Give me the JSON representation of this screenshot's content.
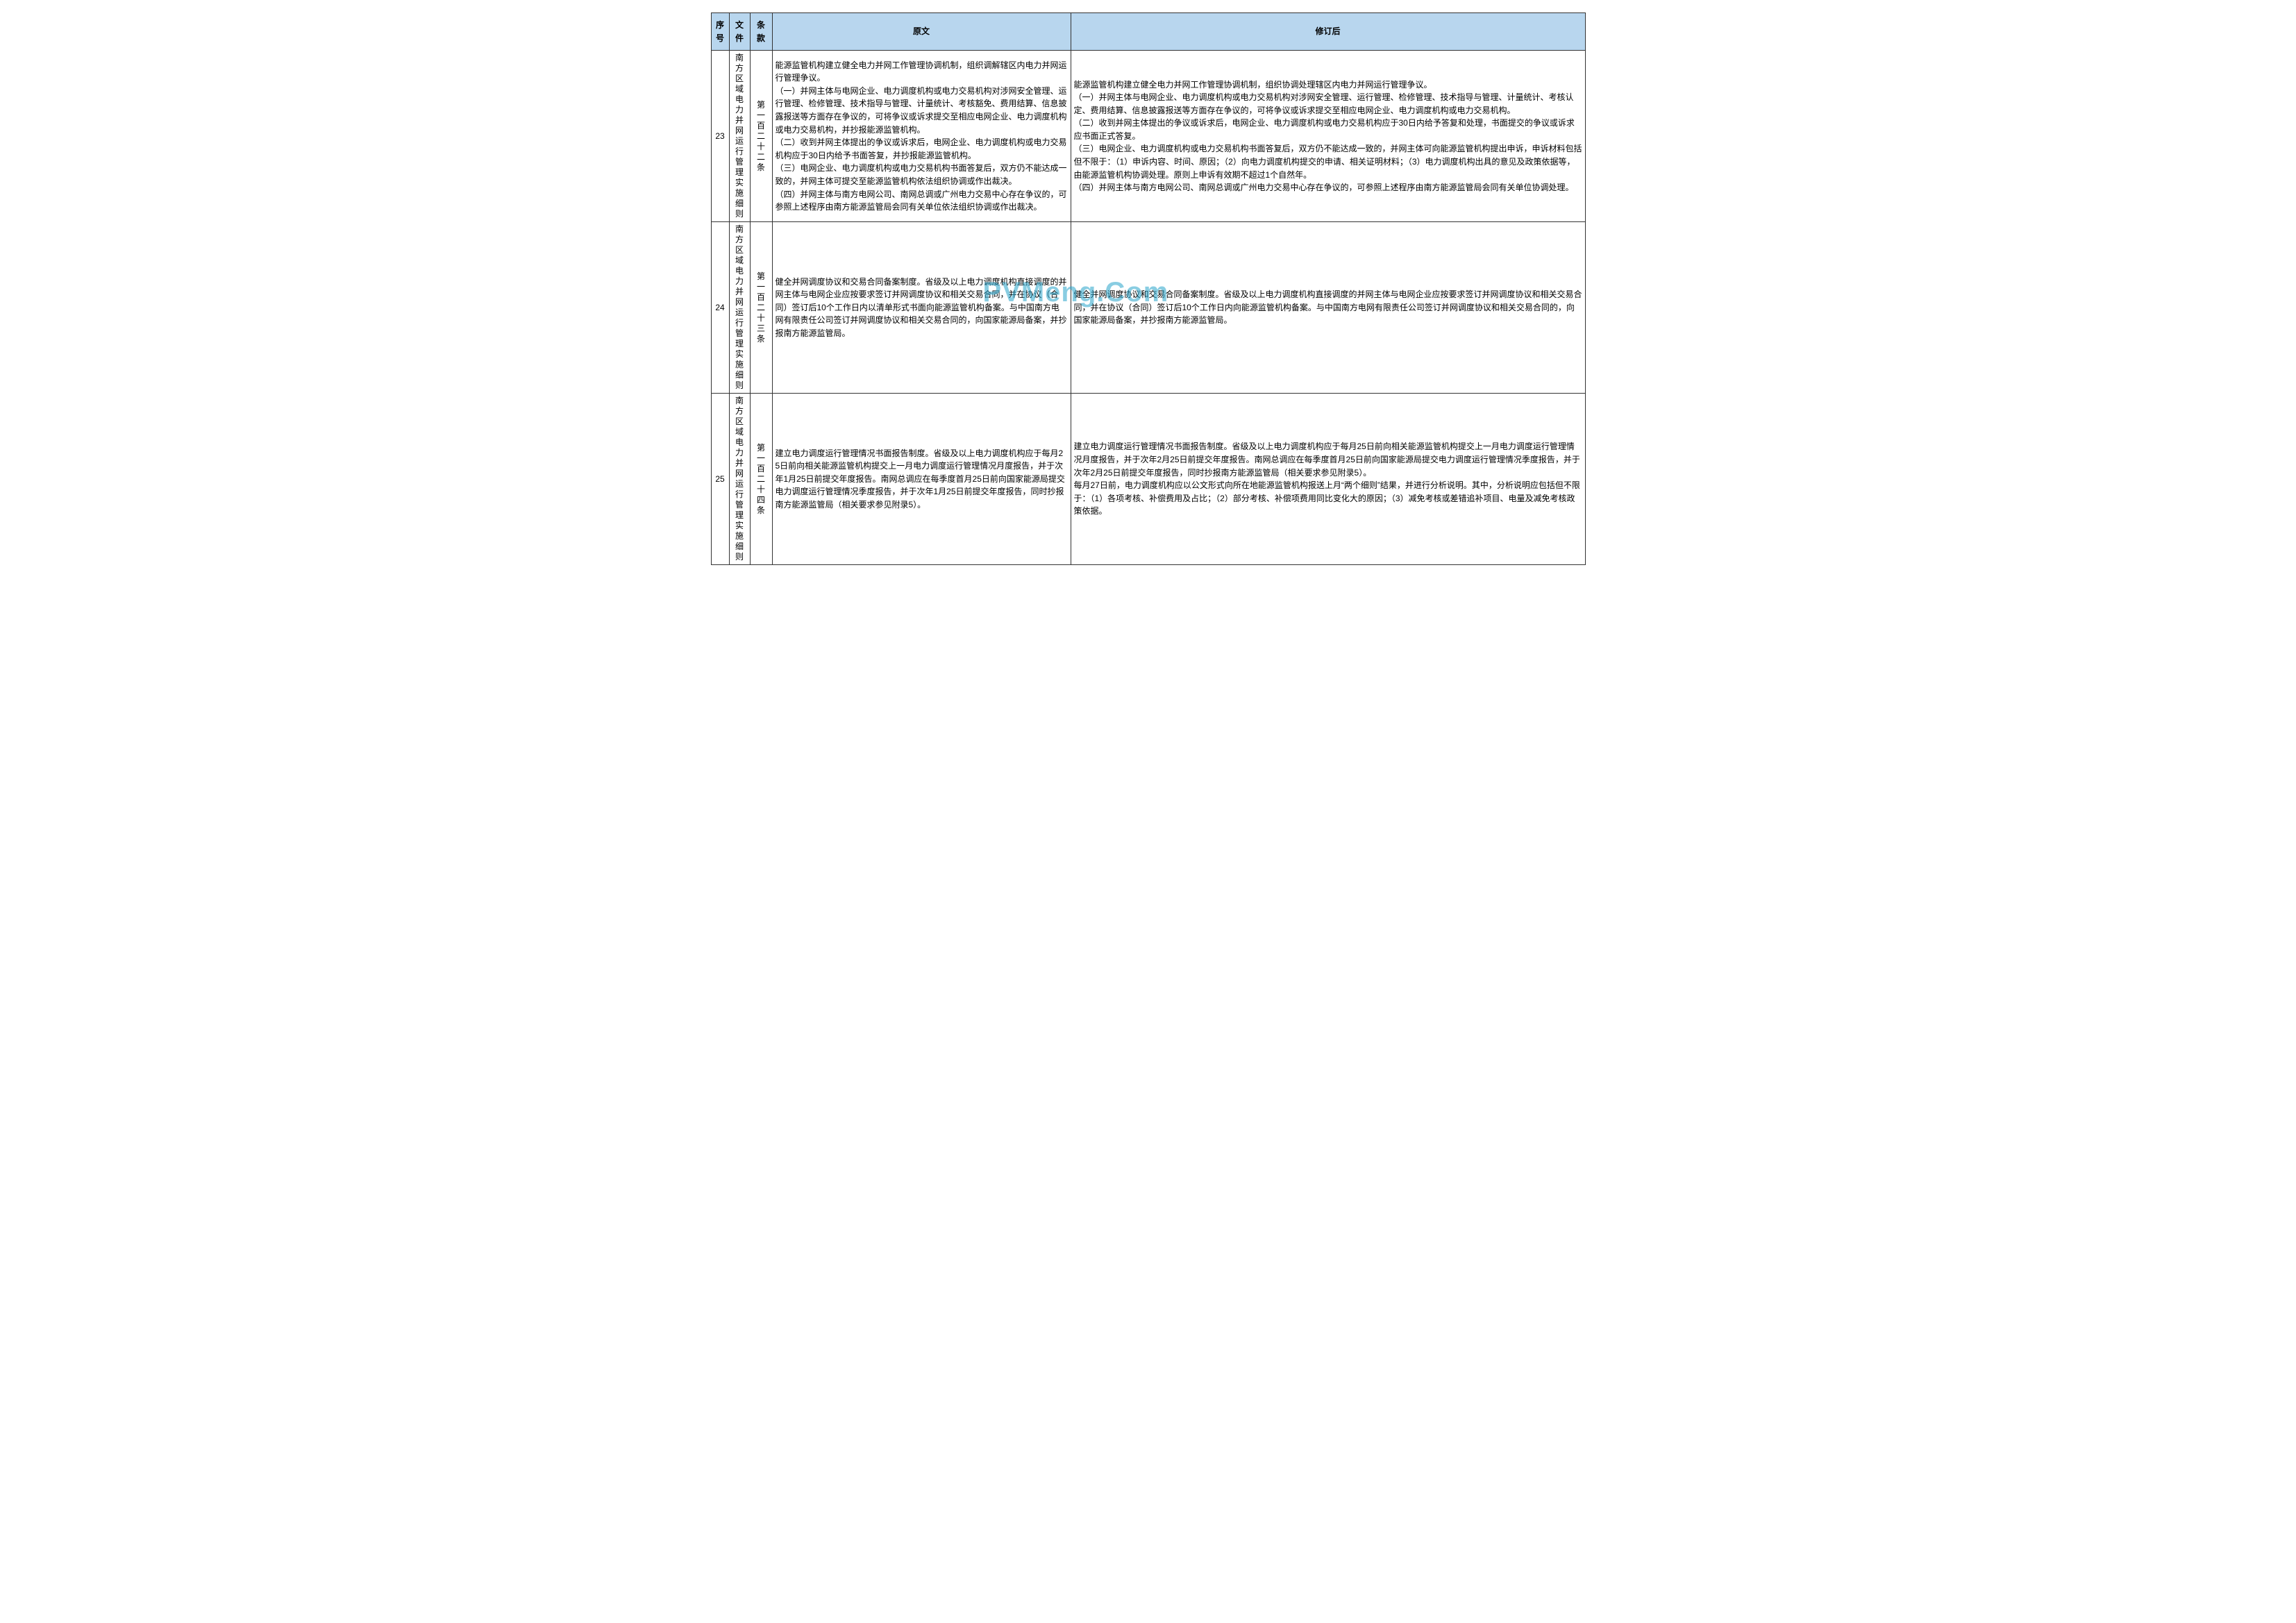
{
  "watermark": "PVMeng.Com",
  "headers": {
    "seq": "序号",
    "file": "文件",
    "article": "条款",
    "original": "原文",
    "revised": "修订后"
  },
  "rows": [
    {
      "seq": "23",
      "file": "南方区域电力并网运行管理实施细则",
      "article": "第一百二十二条",
      "original": "能源监管机构建立健全电力并网工作管理协调机制，组织调解辖区内电力并网运行管理争议。\n（一）并网主体与电网企业、电力调度机构或电力交易机构对涉网安全管理、运行管理、检修管理、技术指导与管理、计量统计、考核豁免、费用结算、信息披露报送等方面存在争议的，可将争议或诉求提交至相应电网企业、电力调度机构或电力交易机构，并抄报能源监管机构。\n（二）收到并网主体提出的争议或诉求后，电网企业、电力调度机构或电力交易机构应于30日内给予书面答复，并抄报能源监管机构。\n（三）电网企业、电力调度机构或电力交易机构书面答复后，双方仍不能达成一致的，并网主体可提交至能源监管机构依法组织协调或作出裁决。\n（四）并网主体与南方电网公司、南网总调或广州电力交易中心存在争议的，可参照上述程序由南方能源监管局会同有关单位依法组织协调或作出裁决。",
      "revised": "能源监管机构建立健全电力并网工作管理协调机制，组织协调处理辖区内电力并网运行管理争议。\n（一）并网主体与电网企业、电力调度机构或电力交易机构对涉网安全管理、运行管理、检修管理、技术指导与管理、计量统计、考核认定、费用结算、信息披露报送等方面存在争议的，可将争议或诉求提交至相应电网企业、电力调度机构或电力交易机构。\n（二）收到并网主体提出的争议或诉求后，电网企业、电力调度机构或电力交易机构应于30日内给予答复和处理，书面提交的争议或诉求应书面正式答复。\n（三）电网企业、电力调度机构或电力交易机构书面答复后，双方仍不能达成一致的，并网主体可向能源监管机构提出申诉，申诉材料包括但不限于：（1）申诉内容、时间、原因；（2）向电力调度机构提交的申请、相关证明材料；（3）电力调度机构出具的意见及政策依据等，由能源监管机构协调处理。原则上申诉有效期不超过1个自然年。\n（四）并网主体与南方电网公司、南网总调或广州电力交易中心存在争议的，可参照上述程序由南方能源监管局会同有关单位协调处理。"
    },
    {
      "seq": "24",
      "file": "南方区域电力并网运行管理实施细则",
      "article": "第一百二十三条",
      "original": "健全并网调度协议和交易合同备案制度。省级及以上电力调度机构直接调度的并网主体与电网企业应按要求签订并网调度协议和相关交易合同，并在协议（合同）签订后10个工作日内以清单形式书面向能源监管机构备案。与中国南方电网有限责任公司签订并网调度协议和相关交易合同的，向国家能源局备案，并抄报南方能源监管局。",
      "revised": "健全并网调度协议和交易合同备案制度。省级及以上电力调度机构直接调度的并网主体与电网企业应按要求签订并网调度协议和相关交易合同，并在协议（合同）签订后10个工作日内向能源监管机构备案。与中国南方电网有限责任公司签订并网调度协议和相关交易合同的，向国家能源局备案，并抄报南方能源监管局。"
    },
    {
      "seq": "25",
      "file": "南方区域电力并网运行管理实施细则",
      "article": "第一百二十四条",
      "original": "建立电力调度运行管理情况书面报告制度。省级及以上电力调度机构应于每月25日前向相关能源监管机构提交上一月电力调度运行管理情况月度报告，并于次年1月25日前提交年度报告。南网总调应在每季度首月25日前向国家能源局提交电力调度运行管理情况季度报告，并于次年1月25日前提交年度报告，同时抄报南方能源监管局（相关要求参见附录5）。",
      "revised": "建立电力调度运行管理情况书面报告制度。省级及以上电力调度机构应于每月25日前向相关能源监管机构提交上一月电力调度运行管理情况月度报告，并于次年2月25日前提交年度报告。南网总调应在每季度首月25日前向国家能源局提交电力调度运行管理情况季度报告，并于次年2月25日前提交年度报告，同时抄报南方能源监管局（相关要求参见附录5）。\n每月27日前，电力调度机构应以公文形式向所在地能源监管机构报送上月“两个细则”结果，并进行分析说明。其中，分析说明应包括但不限于：（1）各项考核、补偿费用及占比；（2）部分考核、补偿项费用同比变化大的原因；（3）减免考核或差错追补项目、电量及减免考核政策依据。"
    }
  ]
}
